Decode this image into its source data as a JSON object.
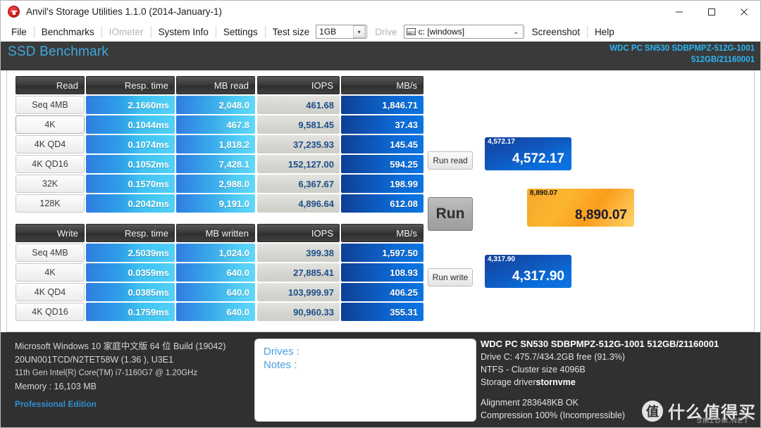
{
  "window": {
    "title": "Anvil's Storage Utilities 1.1.0 (2014-January-1)",
    "app_icon": "anvil-icon",
    "minimize": "minimize-icon",
    "maximize": "maximize-icon",
    "close": "close-icon"
  },
  "menu": {
    "file": "File",
    "benchmarks": "Benchmarks",
    "iometer": "IOmeter",
    "system_info": "System Info",
    "settings": "Settings",
    "test_size_label": "Test size",
    "test_size_value": "1GB",
    "drive_label": "Drive",
    "drive_value": "c: [windows]",
    "screenshot": "Screenshot",
    "help": "Help"
  },
  "header": {
    "title": "SSD Benchmark",
    "device_line1": "WDC PC  SN530 SDBPMPZ-512G-1001",
    "device_line2": "512GB/21160001"
  },
  "read_table": {
    "headers": [
      "Read",
      "Resp. time",
      "MB read",
      "IOPS",
      "MB/s"
    ],
    "rows": [
      {
        "label": "Seq 4MB",
        "resp": "2.1660ms",
        "mb": "2,048.0",
        "iops": "461.68",
        "mbs": "1,846.71",
        "focused": false
      },
      {
        "label": "4K",
        "resp": "0.1044ms",
        "mb": "467.8",
        "iops": "9,581.45",
        "mbs": "37.43",
        "focused": true
      },
      {
        "label": "4K QD4",
        "resp": "0.1074ms",
        "mb": "1,818.2",
        "iops": "37,235.93",
        "mbs": "145.45",
        "focused": false
      },
      {
        "label": "4K QD16",
        "resp": "0.1052ms",
        "mb": "7,428.1",
        "iops": "152,127.00",
        "mbs": "594.25",
        "focused": false
      },
      {
        "label": "32K",
        "resp": "0.1570ms",
        "mb": "2,988.0",
        "iops": "6,367.67",
        "mbs": "198.99",
        "focused": false
      },
      {
        "label": "128K",
        "resp": "0.2042ms",
        "mb": "9,191.0",
        "iops": "4,896.64",
        "mbs": "612.08",
        "focused": false
      }
    ]
  },
  "write_table": {
    "headers": [
      "Write",
      "Resp. time",
      "MB written",
      "IOPS",
      "MB/s"
    ],
    "rows": [
      {
        "label": "Seq 4MB",
        "resp": "2.5039ms",
        "mb": "1,024.0",
        "iops": "399.38",
        "mbs": "1,597.50",
        "focused": false
      },
      {
        "label": "4K",
        "resp": "0.0359ms",
        "mb": "640.0",
        "iops": "27,885.41",
        "mbs": "108.93",
        "focused": false
      },
      {
        "label": "4K QD4",
        "resp": "0.0385ms",
        "mb": "640.0",
        "iops": "103,999.97",
        "mbs": "406.25",
        "focused": false
      },
      {
        "label": "4K QD16",
        "resp": "0.1759ms",
        "mb": "640.0",
        "iops": "90,960.33",
        "mbs": "355.31",
        "focused": false
      }
    ]
  },
  "controls": {
    "run_read": "Run read",
    "run": "Run",
    "run_write": "Run write"
  },
  "scores": {
    "read_small": "4,572.17",
    "read_big": "4,572.17",
    "total_small": "8,890.07",
    "total_big": "8,890.07",
    "write_small": "4,317.90",
    "write_big": "4,317.90"
  },
  "system": {
    "os": "Microsoft Windows 10 家庭中文版 64 位 Build (19042)",
    "model": "20UN001TCD/N2TET58W (1.36 ), U3E1",
    "cpu": "11th Gen Intel(R) Core(TM) i7-1160G7 @ 1.20GHz",
    "memory": "Memory : 16,103 MB",
    "edition": "Professional Edition"
  },
  "notes": {
    "drives": "Drives :",
    "notes": "Notes :"
  },
  "drive_info": {
    "model": "WDC PC  SN530 SDBPMPZ-512G-1001 512GB/21160001",
    "capacity": "Drive C: 475.7/434.2GB free (91.3%)",
    "filesystem": "NTFS - Cluster size 4096B",
    "driver_label": "Storage driver",
    "driver_value": "stornvme",
    "alignment": "Alignment 283648KB OK",
    "compression": "Compression 100% (Incompressible)"
  },
  "watermark": {
    "mark": "值",
    "text": "什么值得买",
    "sub": "SMZDM.NET"
  },
  "colors": {
    "accent": "#3ea9e0",
    "device": "#29b6f6",
    "header_bg": "#3a3a3a",
    "footer_bg": "#303030",
    "score_blue": "#0c6bd6",
    "score_orange": "#fbb530"
  }
}
